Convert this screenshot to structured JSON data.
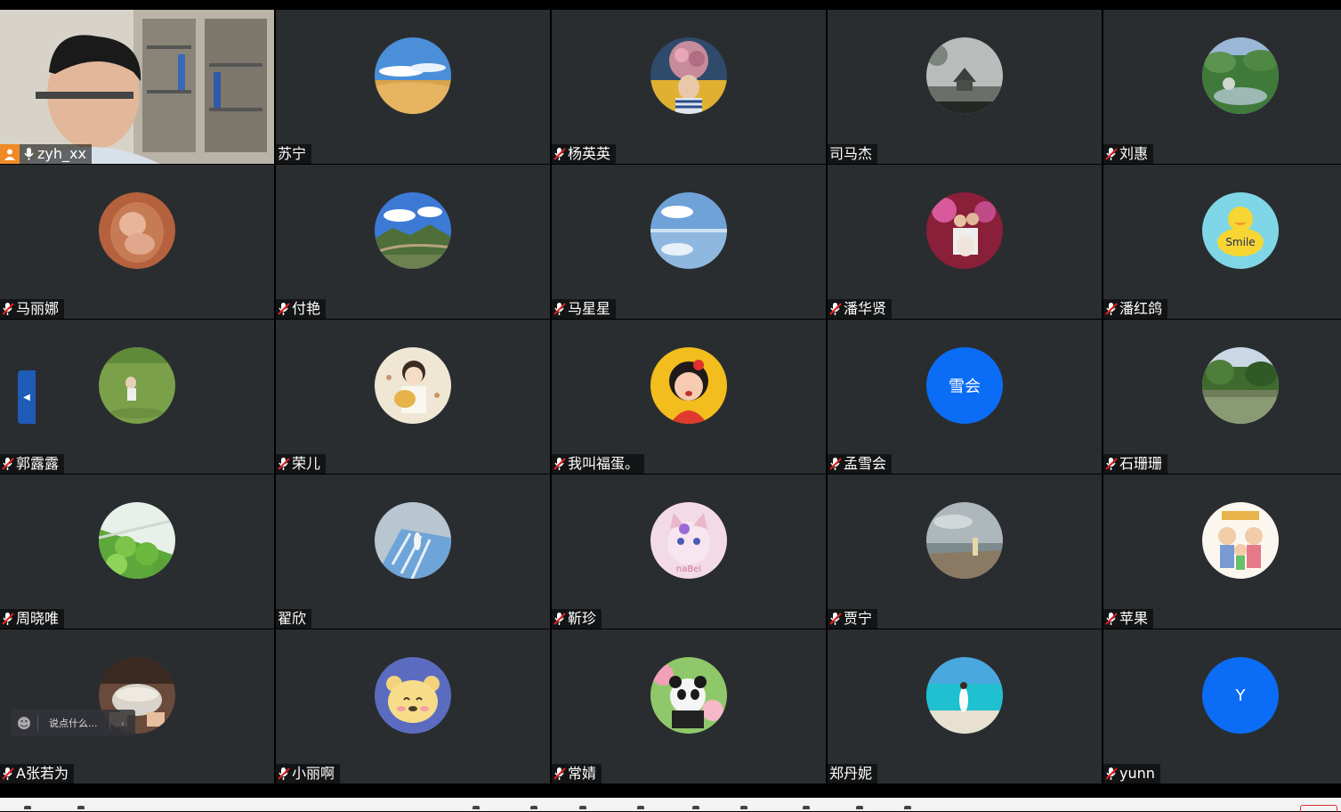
{
  "participants": [
    {
      "name": "zyh_xx",
      "role": "host",
      "video": true
    },
    {
      "name": "苏宁",
      "muted": false,
      "avatar": "desert-photo"
    },
    {
      "name": "杨英英",
      "muted": true,
      "avatar": "girl-with-flowers-photo"
    },
    {
      "name": "司马杰",
      "muted": false,
      "avatar": "pagoda-mist-photo"
    },
    {
      "name": "刘惠",
      "muted": true,
      "avatar": "garden-photo"
    },
    {
      "name": "马丽娜",
      "muted": true,
      "avatar": "baby-photo"
    },
    {
      "name": "付艳",
      "muted": true,
      "avatar": "great-wall-photo"
    },
    {
      "name": "马星星",
      "muted": true,
      "avatar": "salt-flat-photo"
    },
    {
      "name": "潘华贤",
      "muted": true,
      "avatar": "couple-photo"
    },
    {
      "name": "潘红鸽",
      "muted": true,
      "avatar": "smile-duck-illustration"
    },
    {
      "name": "郭露露",
      "muted": true,
      "avatar": "child-on-grass-photo"
    },
    {
      "name": "荣儿",
      "muted": true,
      "avatar": "girl-cartoon"
    },
    {
      "name": "我叫福蛋。",
      "muted": true,
      "avatar": "red-girl-cartoon"
    },
    {
      "name": "孟雪会",
      "muted": true,
      "avatar": "text",
      "avatar_text": "雪会"
    },
    {
      "name": "石珊珊",
      "muted": true,
      "avatar": "lake-photo"
    },
    {
      "name": "周晓唯",
      "muted": true,
      "avatar": "vegetables-photo"
    },
    {
      "name": "翟欣",
      "muted": false,
      "avatar": "stairs-photo"
    },
    {
      "name": "靳珍",
      "muted": true,
      "avatar": "linabell-cartoon"
    },
    {
      "name": "贾宁",
      "muted": true,
      "avatar": "seaside-rocks-photo"
    },
    {
      "name": "苹果",
      "muted": true,
      "avatar": "family-cartoon"
    },
    {
      "name": "A张若为",
      "muted": true,
      "avatar": "bowl-photo"
    },
    {
      "name": "小丽啊",
      "muted": true,
      "avatar": "winnie-pooh-cartoon"
    },
    {
      "name": "常婧",
      "muted": true,
      "avatar": "panda-photo"
    },
    {
      "name": "郑丹妮",
      "muted": false,
      "avatar": "beach-photo"
    },
    {
      "name": "yunn",
      "muted": true,
      "avatar": "text",
      "avatar_text": "Y"
    }
  ],
  "chat": {
    "placeholder": "说点什么..."
  },
  "colors": {
    "tile_bg": "#2a2d30",
    "text_avatar_bg": "#0b6cf5",
    "host_badge": "#f08a24",
    "side_tab": "#1f5cb8"
  }
}
